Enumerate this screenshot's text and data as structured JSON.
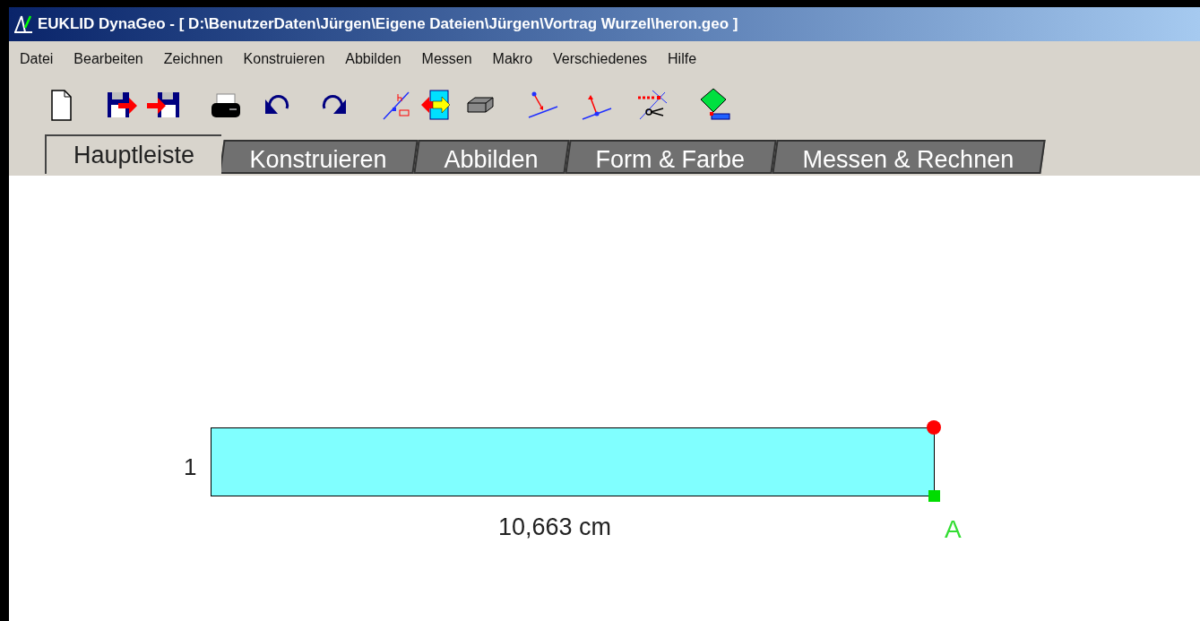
{
  "window": {
    "title": "EUKLID DynaGeo - [ D:\\BenutzerDaten\\Jürgen\\Eigene Dateien\\Jürgen\\Vortrag Wurzel\\heron.geo ]"
  },
  "menu": [
    "Datei",
    "Bearbeiten",
    "Zeichnen",
    "Konstruieren",
    "Abbilden",
    "Messen",
    "Makro",
    "Verschiedenes",
    "Hilfe"
  ],
  "tabs": [
    {
      "label": "Hauptleiste",
      "selected": true
    },
    {
      "label": "Konstruieren",
      "selected": false
    },
    {
      "label": "Abbilden",
      "selected": false
    },
    {
      "label": "Form & Farbe",
      "selected": false
    },
    {
      "label": "Messen & Rechnen",
      "selected": false
    }
  ],
  "canvas": {
    "height_label": "1",
    "width_label": "10,663 cm",
    "point_label": "A"
  }
}
